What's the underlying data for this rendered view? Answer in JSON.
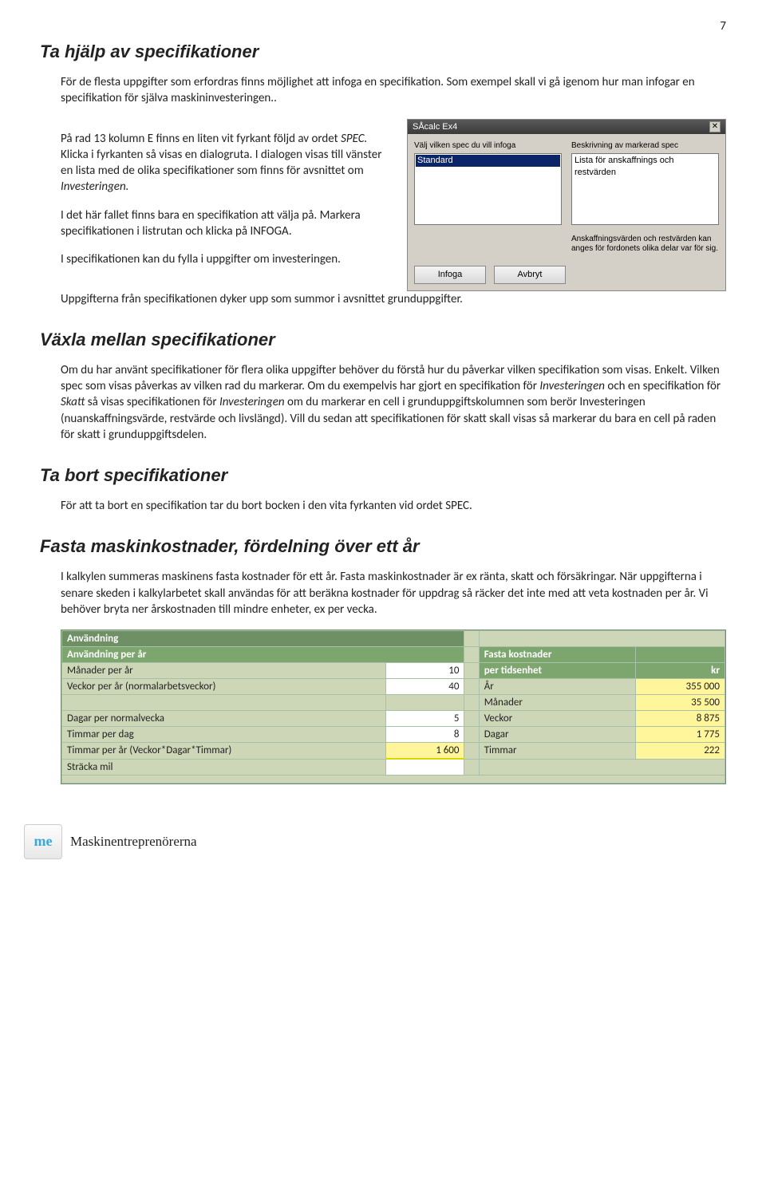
{
  "page_number": "7",
  "sections": {
    "s1": {
      "title": "Ta hjälp av specifikationer",
      "p1": "För de flesta uppgifter som erfordras finns möjlighet att infoga en specifikation. Som exempel skall vi gå igenom hur man infogar en specifikation för själva maskininvesteringen..",
      "p2_pre": " På rad 13 kolumn E finns en liten vit fyrkant följd av ordet ",
      "p2_em": "SPEC.",
      "p2_post": " Klicka i fyrkanten så visas en dialogruta. I dialogen visas till vänster en lista med de olika specifikationer som finns för avsnittet om ",
      "p2_em2": "Investeringen.",
      "p3": "I det här fallet finns bara en specifikation att välja på. Markera specifikationen i listrutan och klicka på INFOGA.",
      "p4a": "I specifikationen kan du fylla i uppgifter om investeringen.",
      "p4b": "Uppgifterna från specifikationen dyker upp som summor i avsnittet grunduppgifter."
    },
    "s2": {
      "title": "Växla mellan specifikationer",
      "p1_a": "Om du har använt specifikationer för flera olika uppgifter behöver du förstå hur du påverkar vilken specifikation som visas. Enkelt. Vilken spec som visas påverkas av vilken rad du markerar. Om du exempelvis har gjort en specifikation för ",
      "p1_em1": "Investeringen",
      "p1_b": " och en specifikation för ",
      "p1_em2": "Skatt",
      "p1_c": " så visas specifikationen för ",
      "p1_em3": "Investeringen",
      "p1_d": " om du markerar en cell i grunduppgiftskolumnen som berör Investeringen (nuanskaffningsvärde, restvärde och livslängd). Vill du sedan att specifikationen för skatt skall visas så markerar du bara en cell på raden för skatt i grunduppgiftsdelen."
    },
    "s3": {
      "title": "Ta bort specifikationer",
      "p1": "För att ta bort en specifikation tar du bort bocken i den vita fyrkanten vid ordet SPEC."
    },
    "s4": {
      "title": "Fasta maskinkostnader, fördelning över ett år",
      "p1": "I kalkylen summeras maskinens fasta kostnader för ett år. Fasta maskinkostnader är ex ränta, skatt och försäkringar. När uppgifterna i senare skeden i kalkylarbetet skall användas för att beräkna kostnader för uppdrag så räcker det inte med att veta kostnaden per år. Vi behöver bryta ner årskostnaden till mindre enheter, ex per vecka."
    }
  },
  "dialog": {
    "title": "SÅcalc Ex4",
    "label_left": "Välj vilken spec du vill infoga",
    "label_right": "Beskrivning av markerad spec",
    "list_left_item": "Standard",
    "list_right_item": "Lista för anskaffnings och restvärden",
    "hint": "Anskaffningsvärden och restvärden kan anges för fordonets olika delar var för sig.",
    "btn_insert": "Infoga",
    "btn_cancel": "Avbryt"
  },
  "table": {
    "hdr_usage": "Användning",
    "hdr_usage_year": "Användning per år",
    "rows_left": [
      {
        "label": "Månader per år",
        "value": "10"
      },
      {
        "label": "Veckor per år (normalarbetsveckor)",
        "value": "40"
      },
      {
        "label": "",
        "value": ""
      },
      {
        "label": "Dagar per normalvecka",
        "value": "5"
      },
      {
        "label": "Timmar per dag",
        "value": "8"
      },
      {
        "label": "Timmar per år      (Veckor*Dagar*Timmar)",
        "value": "1 600"
      },
      {
        "label": "Sträcka mil",
        "value": ""
      }
    ],
    "hdr_right1": "Fasta kostnader",
    "hdr_right2": "per tidsenhet",
    "hdr_right_unit": "kr",
    "rows_right": [
      {
        "label": "År",
        "value": "355 000"
      },
      {
        "label": "Månader",
        "value": "35 500"
      },
      {
        "label": "Veckor",
        "value": "8 875"
      },
      {
        "label": "Dagar",
        "value": "1 775"
      },
      {
        "label": "Timmar",
        "value": "222"
      }
    ]
  },
  "footer": {
    "logo_text": "me",
    "org": "Maskinentreprenörerna"
  }
}
